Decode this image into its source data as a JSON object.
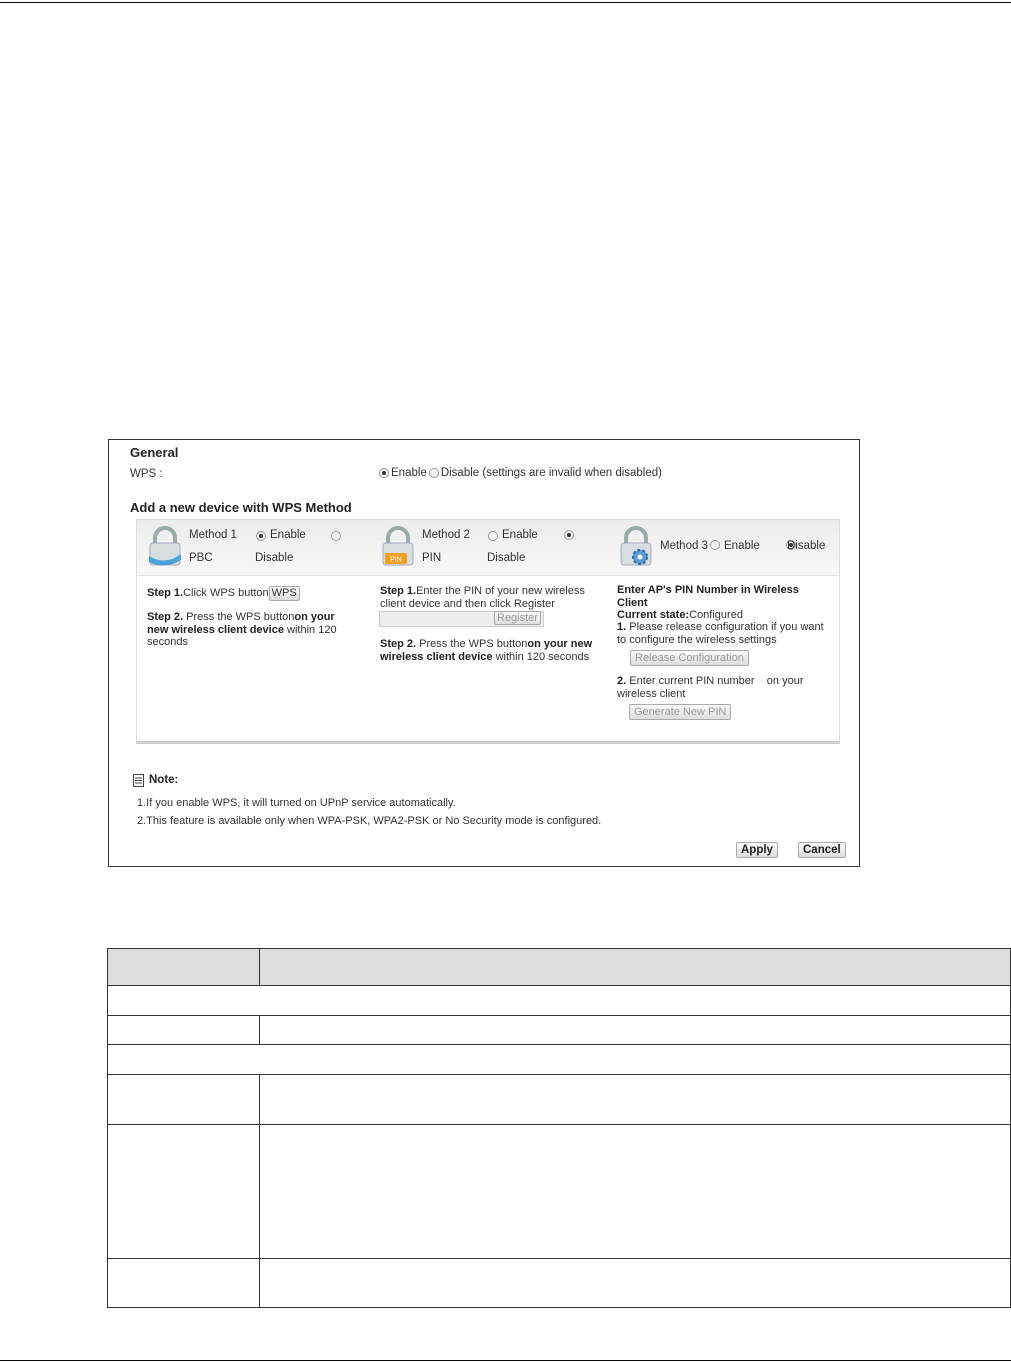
{
  "general": {
    "title": "General",
    "wps_label": "WPS :",
    "enable_label": "Enable",
    "disable_label": "Disable (settings are invalid when disabled)"
  },
  "add_device_title": "Add a new device with WPS Method",
  "method1": {
    "title": "Method 1",
    "sub": "PBC",
    "enable": "Enable",
    "disable": "Disable",
    "step1_bold": "Step 1.",
    "step1_text": "Click WPS button",
    "wps_button": "WPS",
    "step2_bold": "Step 2.",
    "step2_text": "Press the WPS button",
    "step2_bold2": "on your new wireless client device",
    "step2_tail": " within 120 seconds"
  },
  "method2": {
    "title": "Method 2",
    "sub": "PIN",
    "enable": "Enable",
    "disable": "Disable",
    "step1_bold": "Step 1.",
    "step1_text": "Enter the PIN of your new wireless client device and then click Register",
    "pin_value": "",
    "register_button": "Register",
    "step2_bold": "Step 2.",
    "step2_text": "Press the WPS button",
    "step2_bold2": "on your new wireless client device",
    "step2_tail": " within 120 seconds"
  },
  "method3": {
    "title": "Method 3",
    "enable": "Enable",
    "disable": "Disable",
    "heading": "Enter AP's PIN Number in Wireless Client",
    "state_label": "Current state:",
    "state_value": "Configured",
    "item1_num": "1.",
    "item1_text": " Please release configuration if you want to configure the wireless settings",
    "release_button": "Release Configuration",
    "item2_num": "2.",
    "item2_text": " Enter current PIN number    on your wireless client",
    "generate_button": "Generate New PIN"
  },
  "note": {
    "title": "Note:",
    "line1": "1.If you enable WPS, it will turned on UPnP service automatically.",
    "line2": "2.This feature is available only when WPA-PSK, WPA2-PSK or No Security mode is configured."
  },
  "apply_button": "Apply",
  "cancel_button": "Cancel"
}
